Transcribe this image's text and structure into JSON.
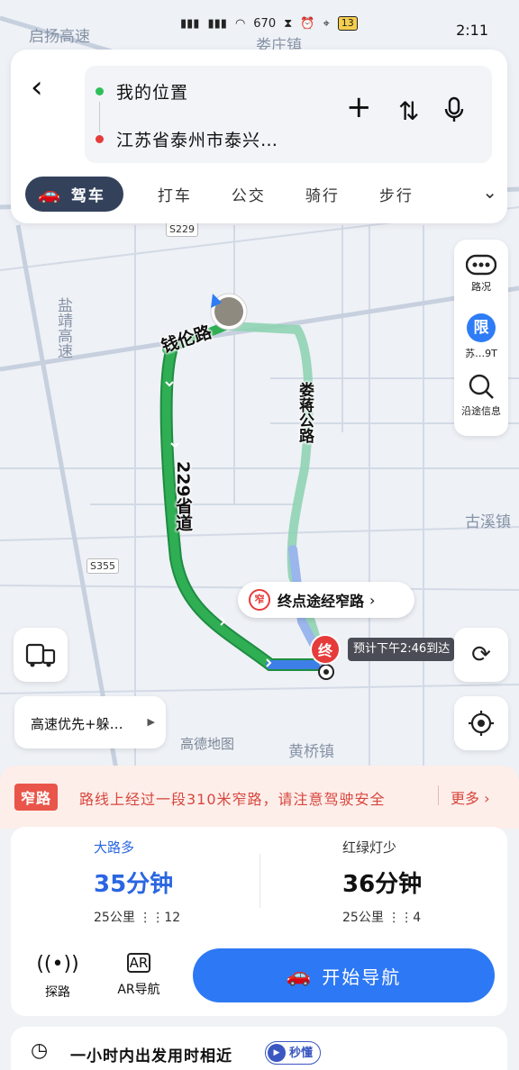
{
  "status_bar": {
    "time": "2:11",
    "net_speed": "670",
    "battery": "13"
  },
  "map": {
    "labels": {
      "town_top": "娄庄镇",
      "road_tl": "启扬高速",
      "road_left": "盐靖高速",
      "town_right": "古溪镇",
      "town_bottom": "黄桥镇",
      "shield_s229": "S229",
      "shield_s355": "S355",
      "route_qianlun": "钱伦路",
      "route_sheng": "229省道",
      "route_loujiang": "娄蒋公路"
    },
    "callout": "终点途经窄路",
    "callout_badge": "窄",
    "end_marker": "终",
    "eta_tag": "预计下午2:46到达",
    "watermark": "高德地图"
  },
  "top_card": {
    "start": "我的位置",
    "end": "江苏省泰州市泰兴…",
    "modes": [
      "驾车",
      "打车",
      "公交",
      "骑行",
      "步行"
    ]
  },
  "side_panel": {
    "traffic_label": "路况",
    "limit_icon": "限",
    "limit_label": "苏…9T",
    "search_label": "沿途信息"
  },
  "preference": "高速优先+躲…",
  "warning": {
    "tag": "窄路",
    "message": "路线上经过一段310米窄路，请注意驾驶安全",
    "more": "更多"
  },
  "plans": [
    {
      "tag": "大路多",
      "duration": "35分钟",
      "distance": "25公里",
      "lights": "12"
    },
    {
      "tag": "红绿灯少",
      "duration": "36分钟",
      "distance": "25公里",
      "lights": "4"
    }
  ],
  "tools": {
    "probe": "探路",
    "ar": "AR导航",
    "ar_icon": "AR"
  },
  "start_nav": "开始导航",
  "hint": {
    "text": "一小时内出发用时相近",
    "badge": "秒懂"
  },
  "colors": {
    "route_green": "#2fae54",
    "route_blue": "#3d7fe6",
    "primary": "#2d78f4",
    "warning_red": "#e9554a"
  }
}
